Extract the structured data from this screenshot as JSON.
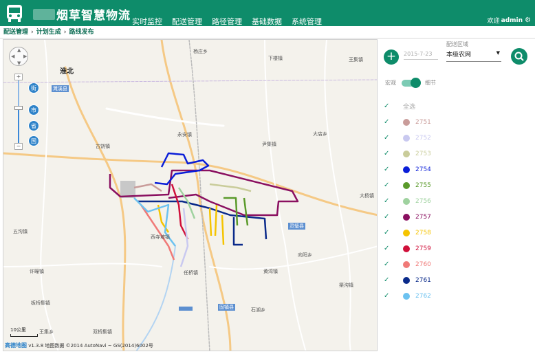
{
  "header": {
    "brand": "烟草智慧物流",
    "nav": [
      "实时监控",
      "配送管理",
      "路径管理",
      "基础数据",
      "系统管理"
    ],
    "welcome": "欢迎",
    "username": "admin"
  },
  "breadcrumb": [
    "配送管理",
    "计划生成",
    "路线发布"
  ],
  "map": {
    "labels": [
      {
        "t": "淮北",
        "big": true
      },
      {
        "t": "杨庄乡"
      },
      {
        "t": "下楼镇"
      },
      {
        "t": "王集镇"
      },
      {
        "t": "古饶镇"
      },
      {
        "t": "永安镇"
      },
      {
        "t": "尹集镇"
      },
      {
        "t": "大店乡"
      },
      {
        "t": "五沟镇"
      },
      {
        "t": "许疃镇"
      },
      {
        "t": "板桥集镇"
      },
      {
        "t": "任桥镇"
      },
      {
        "t": "西寺坡镇"
      },
      {
        "t": "双桥集镇"
      },
      {
        "t": "王集乡"
      },
      {
        "t": "大杨镇"
      },
      {
        "t": "向阳乡"
      },
      {
        "t": "石湖乡"
      },
      {
        "t": "黄湾镇"
      },
      {
        "t": "渠沟镇"
      }
    ],
    "towns": [
      "濉溪县",
      "灵璧县",
      "固镇县"
    ],
    "scale": "10公里",
    "attribution": "v1.3.8 地图数据 ©2014 AutoNavi ~ GS(2014)6002号",
    "brand": "高德地图",
    "levels": [
      "街",
      "市",
      "省",
      "国"
    ]
  },
  "panel": {
    "date": "2015-7-23",
    "area_label": "配送区域",
    "area_value": "本级农网",
    "toggle_left": "宏观",
    "toggle_right": "细节",
    "select_all": "全选",
    "routes": [
      {
        "id": "2751",
        "color": "#c99c9a"
      },
      {
        "id": "2752",
        "color": "#c9c9f0"
      },
      {
        "id": "2753",
        "color": "#c9cc9a"
      },
      {
        "id": "2754",
        "color": "#0a1ed8"
      },
      {
        "id": "2755",
        "color": "#5a9a2a"
      },
      {
        "id": "2756",
        "color": "#9fd29f"
      },
      {
        "id": "2757",
        "color": "#8a1060"
      },
      {
        "id": "2758",
        "color": "#f5c400"
      },
      {
        "id": "2759",
        "color": "#d0103a"
      },
      {
        "id": "2760",
        "color": "#f07a78"
      },
      {
        "id": "2761",
        "color": "#0a2a8a"
      },
      {
        "id": "2762",
        "color": "#6cc2f0"
      }
    ]
  }
}
